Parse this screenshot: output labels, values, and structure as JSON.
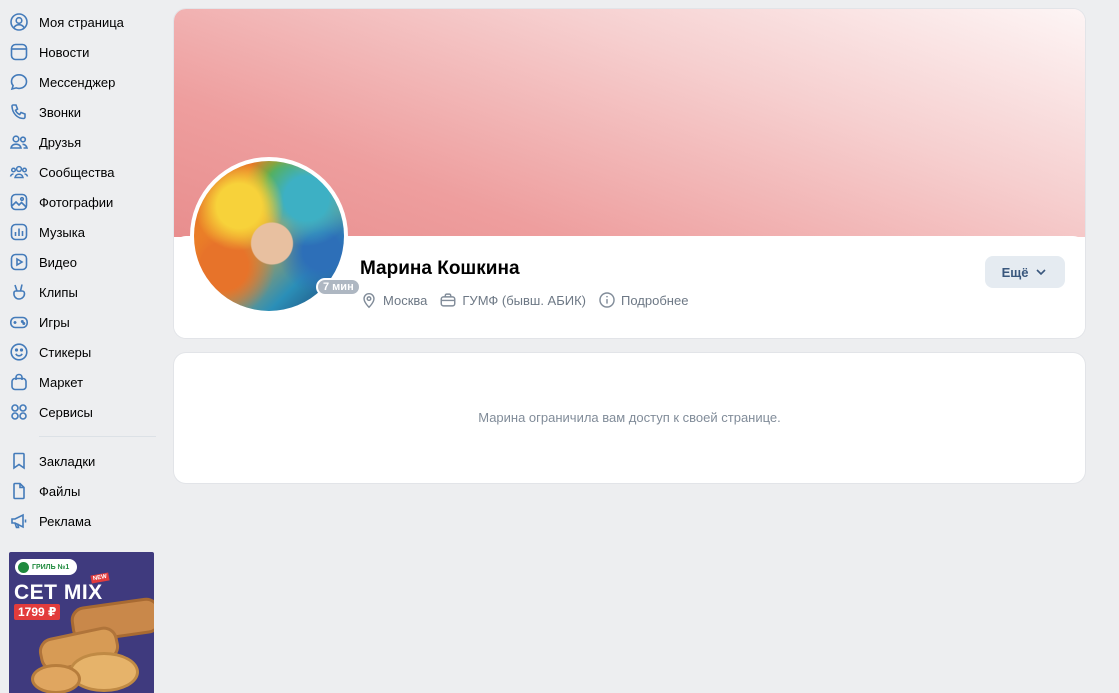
{
  "sidebar": {
    "items": [
      {
        "label": "Моя страница",
        "icon": "user-circle-icon"
      },
      {
        "label": "Новости",
        "icon": "news-icon"
      },
      {
        "label": "Мессенджер",
        "icon": "message-icon"
      },
      {
        "label": "Звонки",
        "icon": "phone-icon"
      },
      {
        "label": "Друзья",
        "icon": "friends-icon"
      },
      {
        "label": "Сообщества",
        "icon": "communities-icon"
      },
      {
        "label": "Фотографии",
        "icon": "photo-icon"
      },
      {
        "label": "Музыка",
        "icon": "music-icon"
      },
      {
        "label": "Видео",
        "icon": "video-icon"
      },
      {
        "label": "Клипы",
        "icon": "clips-icon"
      },
      {
        "label": "Игры",
        "icon": "gamepad-icon"
      },
      {
        "label": "Стикеры",
        "icon": "smile-icon"
      },
      {
        "label": "Маркет",
        "icon": "bag-icon"
      },
      {
        "label": "Сервисы",
        "icon": "services-icon"
      }
    ],
    "extra_items": [
      {
        "label": "Закладки",
        "icon": "bookmark-icon"
      },
      {
        "label": "Файлы",
        "icon": "file-icon"
      },
      {
        "label": "Реклама",
        "icon": "megaphone-icon"
      }
    ]
  },
  "ad": {
    "brand": "ГРИЛЬ №1",
    "badge": "NEW",
    "title": "СЕТ MIX",
    "price": "1799 ₽"
  },
  "profile": {
    "name": "Марина Кошкина",
    "online": "7 мин",
    "city": "Москва",
    "education": "ГУМФ (бывш. АБИК)",
    "details_link": "Подробнее",
    "more_button": "Ещё"
  },
  "restricted": {
    "message": "Марина ограничила вам доступ к своей странице."
  },
  "colors": {
    "background": "#edeef0",
    "accent": "#447bba",
    "cover_gradient_end": "#e88e8e",
    "secondary_text": "#818c99"
  }
}
